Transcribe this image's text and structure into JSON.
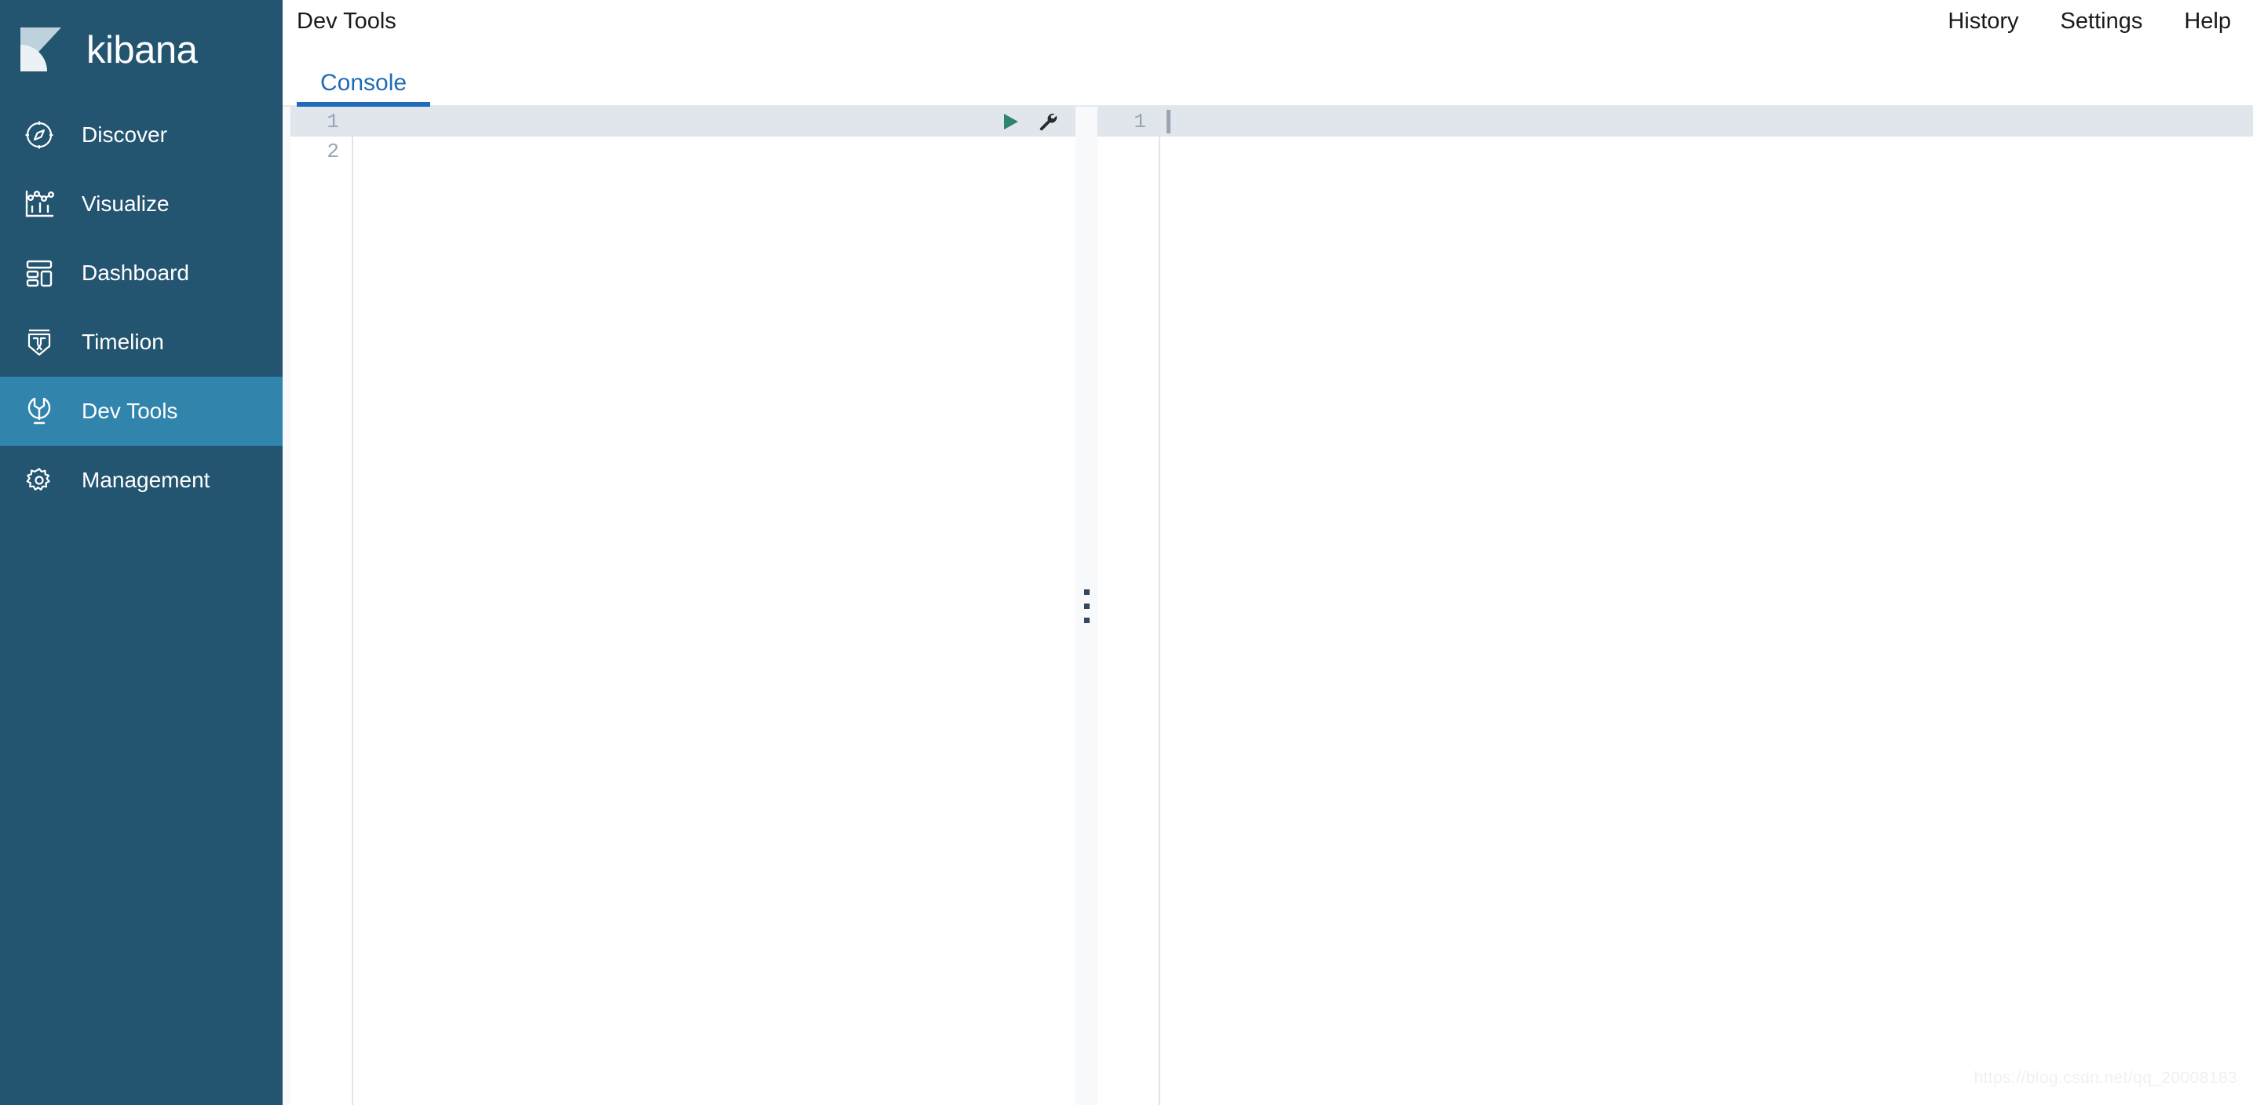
{
  "brand": {
    "name": "kibana",
    "logo_icon": "kibana-logo-icon"
  },
  "colors": {
    "sidebar_bg": "#235470",
    "sidebar_active_bg": "#3185ad",
    "accent_blue": "#1f6bb8",
    "play_green": "#2f8372",
    "gutter_text": "#9aa5b4",
    "active_line_bg": "#e1e5ec",
    "console_bg": "#f7f9fb",
    "text_dark": "#1a1a1a"
  },
  "sidebar": {
    "items": [
      {
        "label": "Discover",
        "icon": "compass-icon",
        "active": false
      },
      {
        "label": "Visualize",
        "icon": "bar-chart-icon",
        "active": false
      },
      {
        "label": "Dashboard",
        "icon": "dashboard-icon",
        "active": false
      },
      {
        "label": "Timelion",
        "icon": "timelion-icon",
        "active": false
      },
      {
        "label": "Dev Tools",
        "icon": "wrench-icon",
        "active": true
      },
      {
        "label": "Management",
        "icon": "gear-icon",
        "active": false
      }
    ]
  },
  "topbar": {
    "app_title": "Dev Tools",
    "links": [
      {
        "label": "History",
        "name": "history-link"
      },
      {
        "label": "Settings",
        "name": "settings-link"
      },
      {
        "label": "Help",
        "name": "help-link"
      }
    ]
  },
  "tabs": [
    {
      "label": "Console",
      "active": true
    }
  ],
  "console": {
    "request_editor": {
      "line_numbers": [
        "1",
        "2"
      ],
      "active_line_number": "1",
      "content_lines": [
        "",
        ""
      ],
      "actions": [
        {
          "label": "Click to send request",
          "icon": "play-icon",
          "name": "send-request-button"
        },
        {
          "label": "Open documentation",
          "icon": "wrench-icon",
          "name": "request-options-button"
        }
      ]
    },
    "response_editor": {
      "line_numbers": [
        "1"
      ],
      "active_line_number": "1",
      "content_lines": [
        ""
      ]
    },
    "resizer": {
      "icon": "grip-dots-icon",
      "dot_count": 3
    }
  },
  "watermark": {
    "text": "https://blog.csdn.net/qq_20008183"
  }
}
